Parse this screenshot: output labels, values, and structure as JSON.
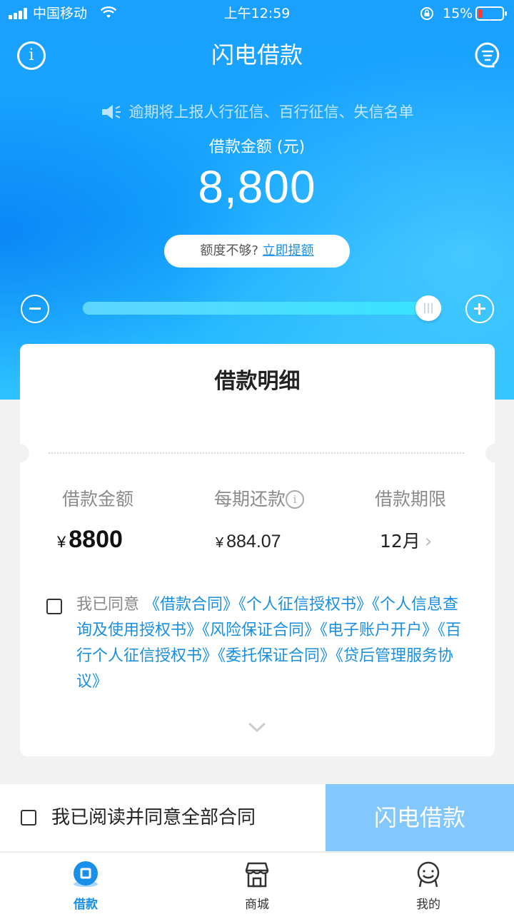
{
  "status_bar": {
    "carrier": "中国移动",
    "time": "上午12:59",
    "battery": "15%"
  },
  "header": {
    "title": "闪电借款"
  },
  "notice": "逾期将上报人行征信、百行征信、失信名单",
  "loan": {
    "amount_label": "借款金额 (元)",
    "amount": "8,800",
    "raise_prefix": "额度不够?",
    "raise_link": "立即提额",
    "slider_fraction": 0.96
  },
  "card": {
    "title": "借款明细",
    "col1_label": "借款金额",
    "col2_label": "每期还款",
    "col3_label": "借款期限",
    "currency": "¥",
    "amount_value": "8800",
    "monthly_value": "884.07",
    "term_value": "12月",
    "agree_prefix": "我已同意",
    "contracts": "《借款合同》《个人征信授权书》《个人信息查询及使用授权书》《风险保证合同》《电子账户开户》《百行个人征信授权书》《委托保证合同》《贷后管理服务协议》"
  },
  "bottom": {
    "agree_all": "我已阅读并同意全部合同",
    "submit": "闪电借款"
  },
  "tabs": [
    {
      "label": "借款",
      "icon": "loan-icon"
    },
    {
      "label": "商城",
      "icon": "shop-icon"
    },
    {
      "label": "我的",
      "icon": "profile-icon"
    }
  ],
  "colors": {
    "brand": "#1a9bff",
    "link": "#1a8fe0",
    "submit_disabled": "#82c8ff"
  }
}
